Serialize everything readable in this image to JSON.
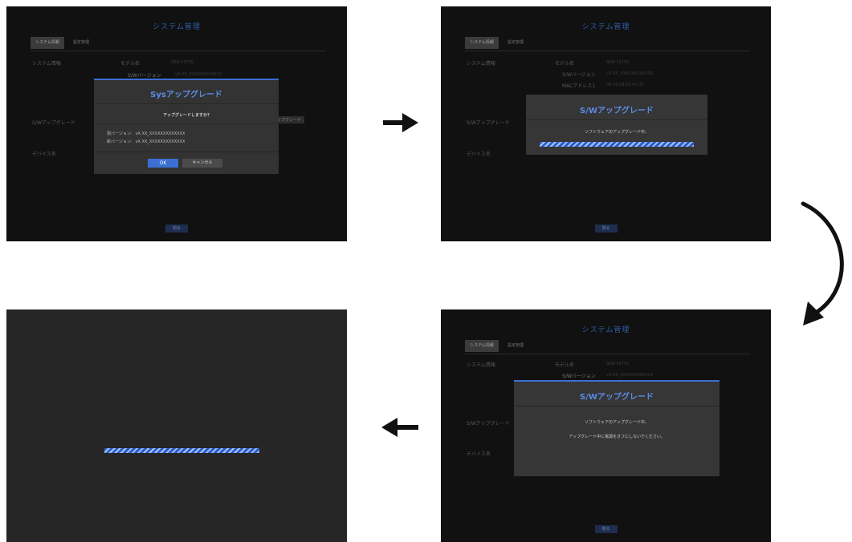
{
  "screen_title": "システム管理",
  "tabs": {
    "system_info": "システム情報",
    "settings_mgmt": "設定管理"
  },
  "info": {
    "section_system_info": "システム情報",
    "model_label": "モデル名",
    "model_value": "SRN-1673S",
    "sw_version_label": "S/Wバージョン",
    "sw_version_value": "vX.XX_XXXXXXXXXXXX",
    "mac_label": "MACアドレス1",
    "mac_value": "00:09:18:50:A7:35",
    "section_sw_upgrade": "S/Wアップグレード",
    "upgrade_button": "アップグレード",
    "section_device_name": "デバイス名",
    "close_button": "閉る"
  },
  "dialog_confirm": {
    "title": "Sysアップグレード",
    "question": "アップグレードしますか?",
    "current_version_label": "現バージョン:",
    "current_version_value": "vX.XX_XXXXXXXXXXXXX",
    "new_version_label": "新バージョン:",
    "new_version_value": "vX.XX_XXXXXXXXXXXXX",
    "ok_label": "OK",
    "cancel_label": "キャンセル"
  },
  "dialog_progress": {
    "title": "S/Wアップグレード",
    "message": "ソフトウェアのアップグレード中。",
    "warning": "アップグレード中に電源をオフにしないでください。"
  },
  "colors": {
    "accent": "#3b6fd4",
    "title_blue": "#5b8be4",
    "panel_bg": "#111111",
    "dialog_bg": "#333333"
  },
  "icons": [
    "arrow-right-icon",
    "curved-arrow-down-icon",
    "arrow-left-icon"
  ]
}
